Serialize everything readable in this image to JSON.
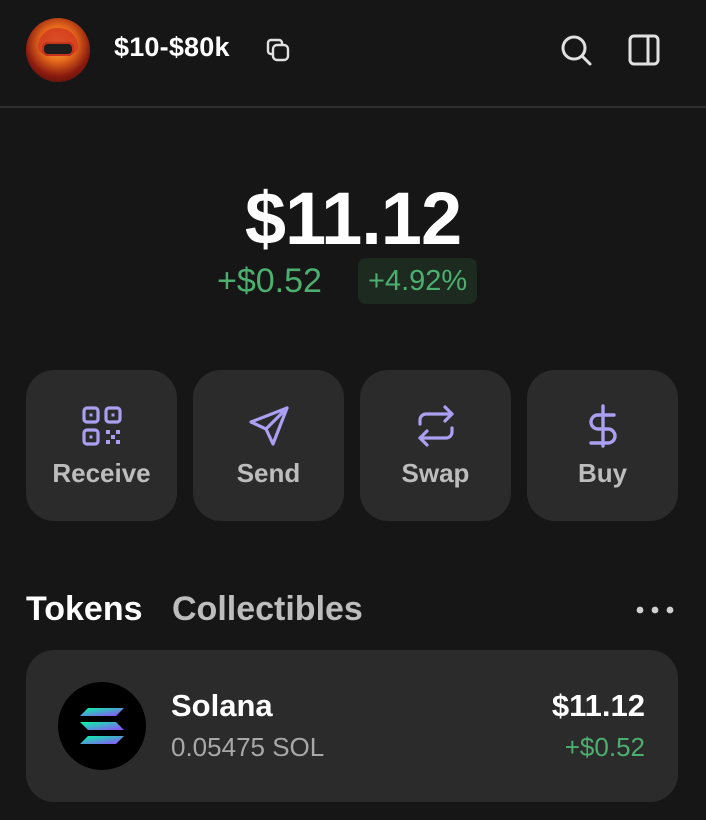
{
  "header": {
    "account_name": "$10-$80k",
    "icons": [
      "copy-icon",
      "search-icon",
      "sidebar-toggle-icon"
    ]
  },
  "balance": {
    "total": "$11.12",
    "change_amount": "+$0.52",
    "change_percent": "+4.92%"
  },
  "actions": [
    {
      "label": "Receive",
      "icon": "qr-code-icon"
    },
    {
      "label": "Send",
      "icon": "paper-plane-icon"
    },
    {
      "label": "Swap",
      "icon": "swap-arrows-icon"
    },
    {
      "label": "Buy",
      "icon": "dollar-icon"
    }
  ],
  "tabs": {
    "tokens": "Tokens",
    "collectibles": "Collectibles"
  },
  "tokens": [
    {
      "name": "Solana",
      "amount": "0.05475 SOL",
      "value": "$11.12",
      "change": "+$0.52"
    }
  ],
  "colors": {
    "background": "#161616",
    "card": "#2b2b2b",
    "accent": "#ab9ff2",
    "positive": "#4caf6f"
  }
}
